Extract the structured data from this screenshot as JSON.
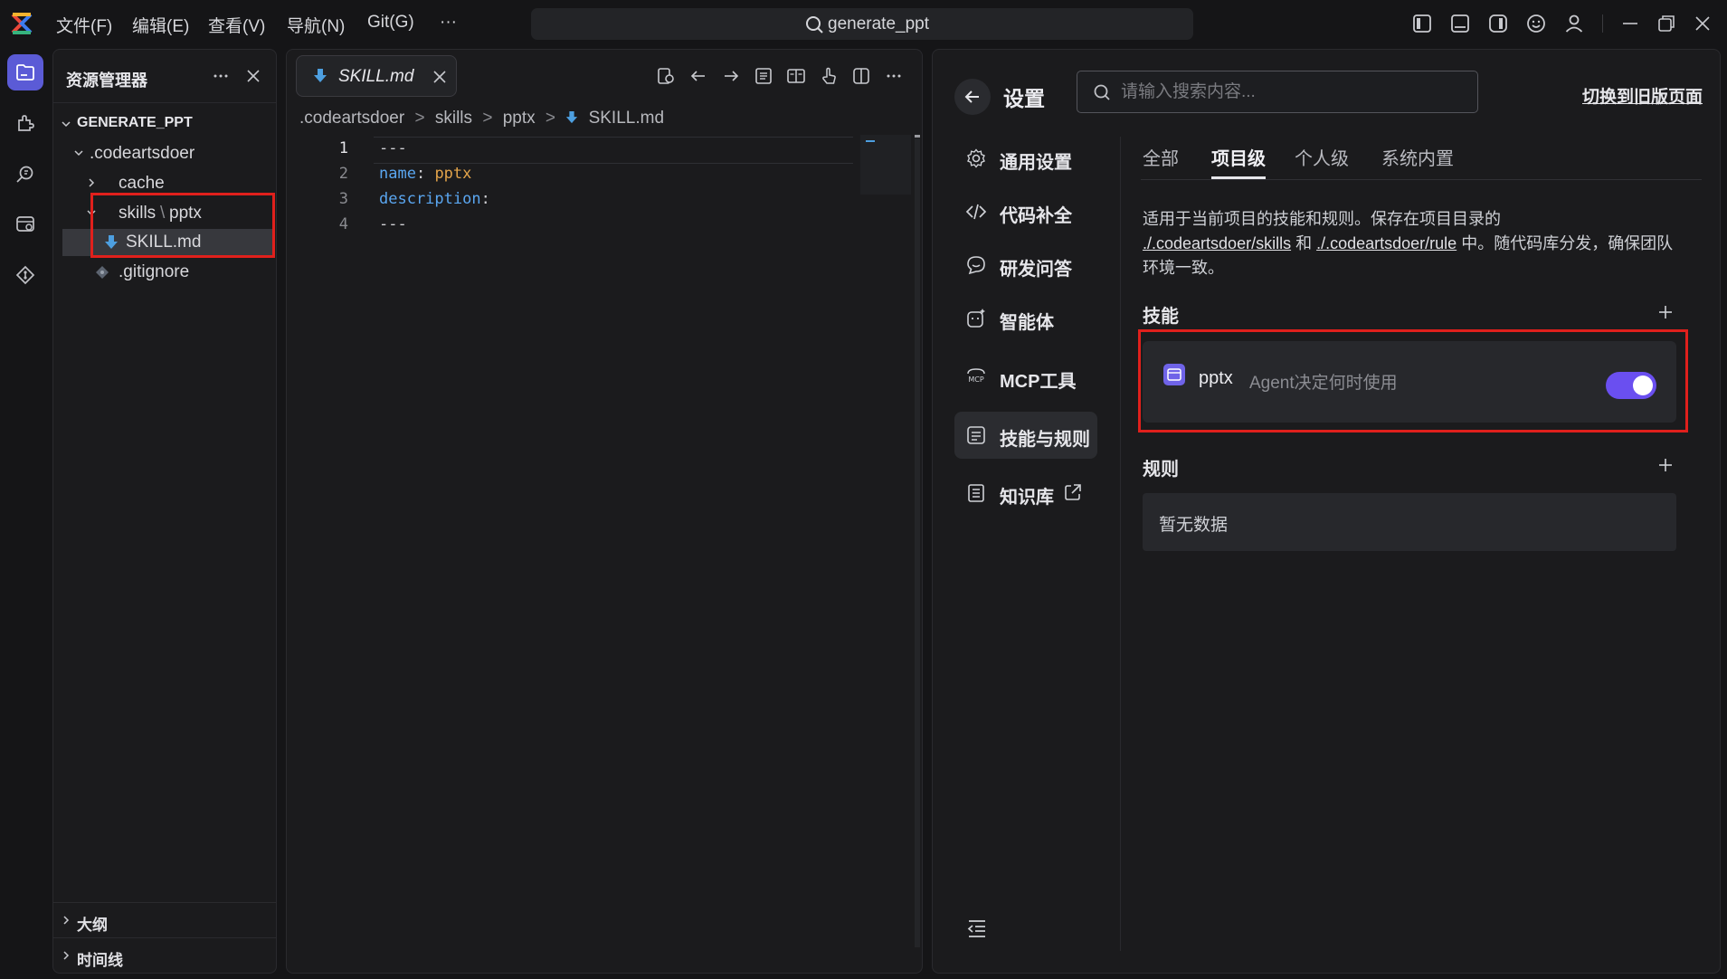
{
  "titlebar": {
    "menus": [
      "文件(F)",
      "编辑(E)",
      "查看(V)",
      "导航(N)",
      "Git(G)",
      "···"
    ],
    "search_text": "generate_ppt"
  },
  "explorer": {
    "title": "资源管理器",
    "root": "GENERATE_PPT",
    "tree": [
      ".codeartsdoer",
      "cache",
      "skills",
      "pptx",
      "SKILL.md",
      ".gitignore"
    ],
    "sections": [
      "大纲",
      "时间线"
    ]
  },
  "editor": {
    "tab_name": "SKILL.md",
    "breadcrumb": [
      ".codeartsdoer",
      "skills",
      "pptx",
      "SKILL.md"
    ],
    "lines": [
      {
        "n": "1",
        "k": "",
        "sep": "---",
        "v": ""
      },
      {
        "n": "2",
        "k": "name",
        "sep": ": ",
        "v": "pptx"
      },
      {
        "n": "3",
        "k": "description",
        "sep": ":",
        "v": ""
      },
      {
        "n": "4",
        "k": "",
        "sep": "---",
        "v": ""
      }
    ]
  },
  "settings": {
    "title": "设置",
    "search_placeholder": "请输入搜索内容...",
    "switch_link": "切换到旧版页面",
    "nav": [
      "通用设置",
      "代码补全",
      "研发问答",
      "智能体",
      "MCP工具",
      "技能与规则",
      "知识库"
    ],
    "tabs": [
      "全部",
      "项目级",
      "个人级",
      "系统内置"
    ],
    "desc_prefix": "适用于当前项目的技能和规则。保存在项目目录的",
    "desc_link1": "./.codeartsdoer/skills",
    "desc_and": " 和 ",
    "desc_link2": "./.codeartsdoer/rule",
    "desc_suffix": " 中。随代码库分发，确保团队环境一致。",
    "skills_title": "技能",
    "skill_name": "pptx",
    "skill_mode": "Agent决定何时使用",
    "skill_enabled": true,
    "rules_title": "规则",
    "rules_empty": "暂无数据"
  },
  "colors": {
    "accent": "#5b5bd6",
    "toggle": "#6a4ff0",
    "highlight_box": "#e0201c"
  }
}
